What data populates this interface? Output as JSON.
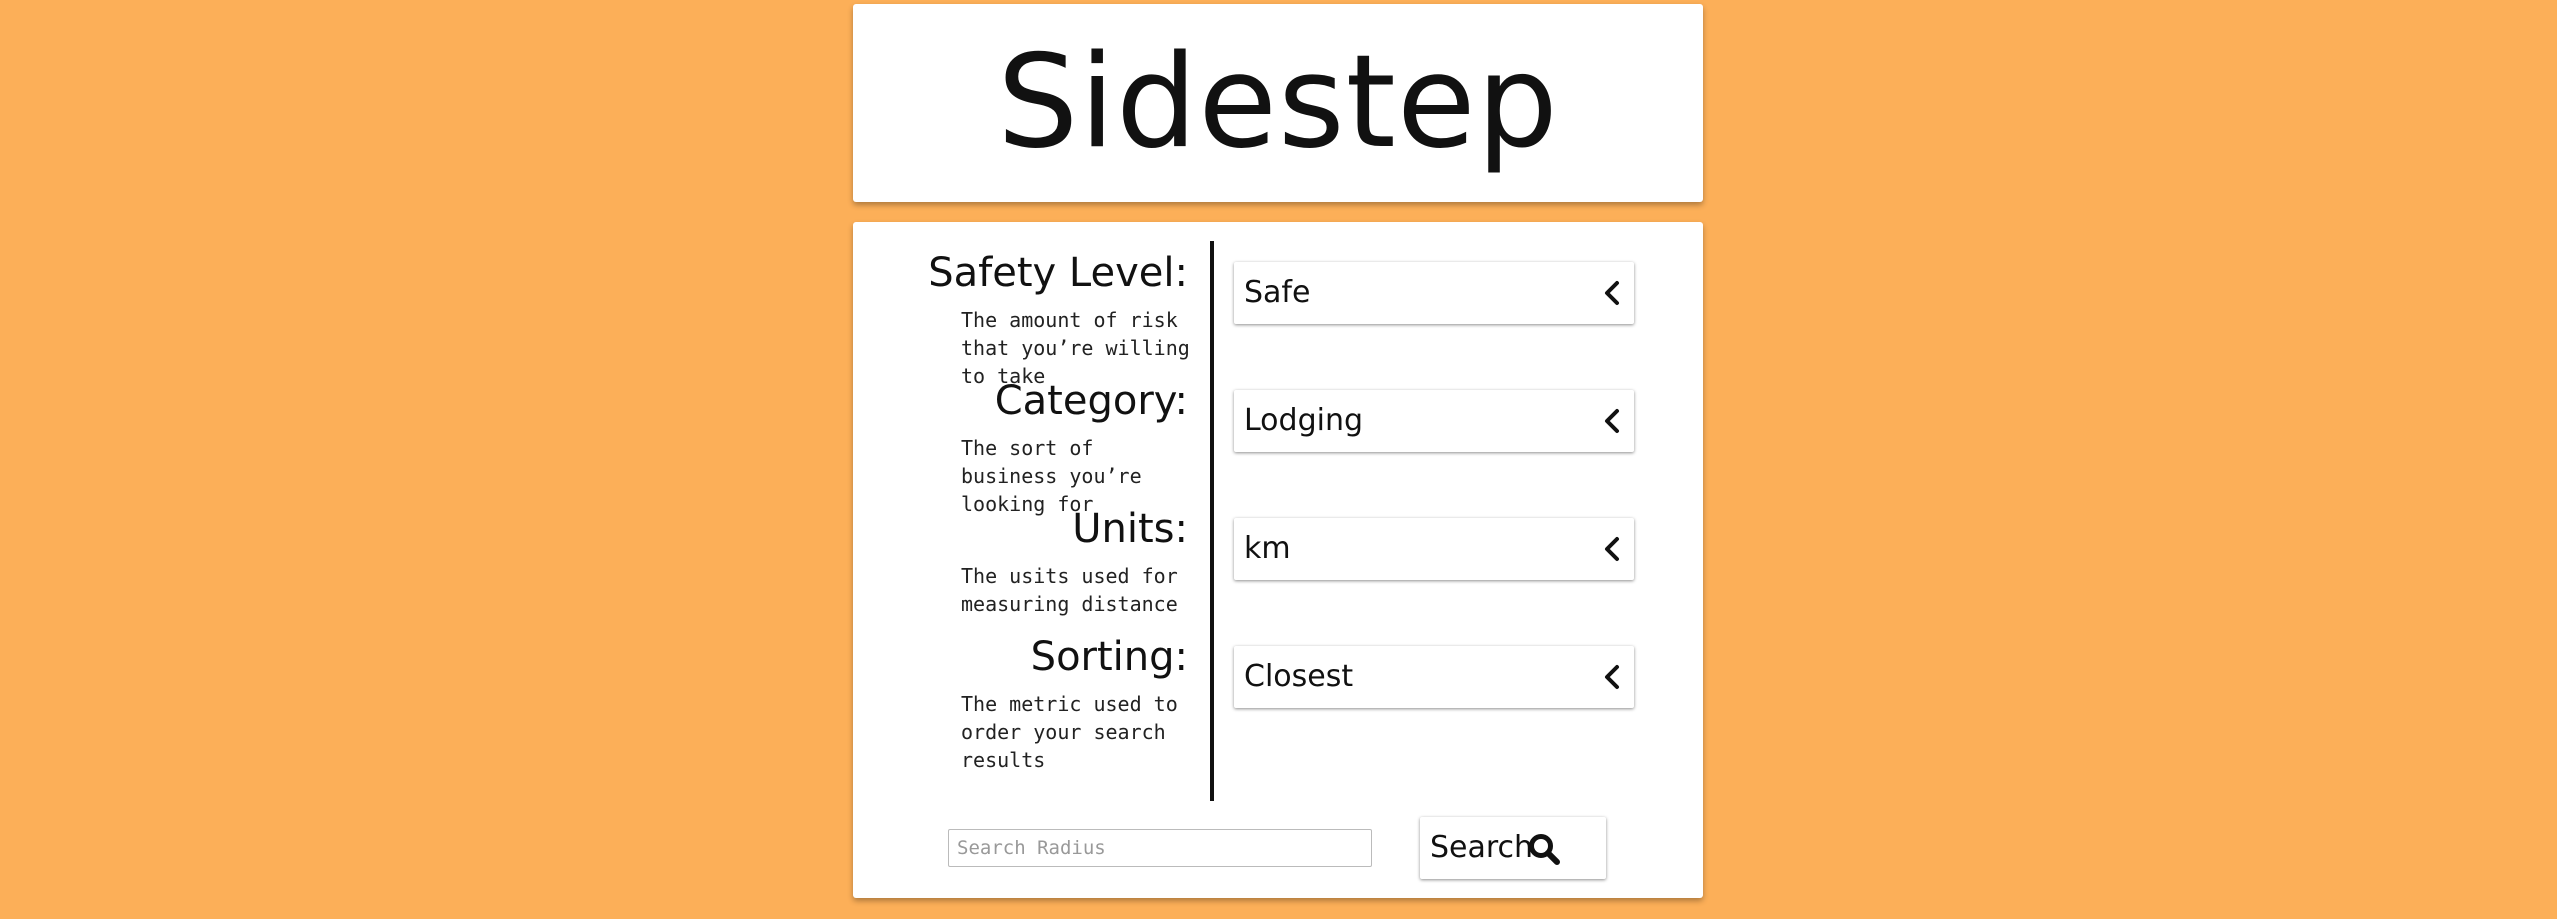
{
  "app": {
    "title": "Sidestep"
  },
  "fields": [
    {
      "label": "Safety Level:",
      "description": "The amount of risk that you’re willing to take",
      "value": "Safe"
    },
    {
      "label": "Category:",
      "description": "The sort of business you’re looking for",
      "value": "Lodging"
    },
    {
      "label": "Units:",
      "description": "The usits used for measuring distance",
      "value": "km"
    },
    {
      "label": "Sorting:",
      "description": "The metric used to order your search results",
      "value": "Closest"
    }
  ],
  "search": {
    "placeholder": "Search Radius",
    "button_label": "Search"
  },
  "icons": {
    "select": "chevron-left-icon",
    "search": "magnifier-icon"
  },
  "colors": {
    "background": "#fcaf58",
    "card": "#ffffff",
    "text": "#111111"
  }
}
